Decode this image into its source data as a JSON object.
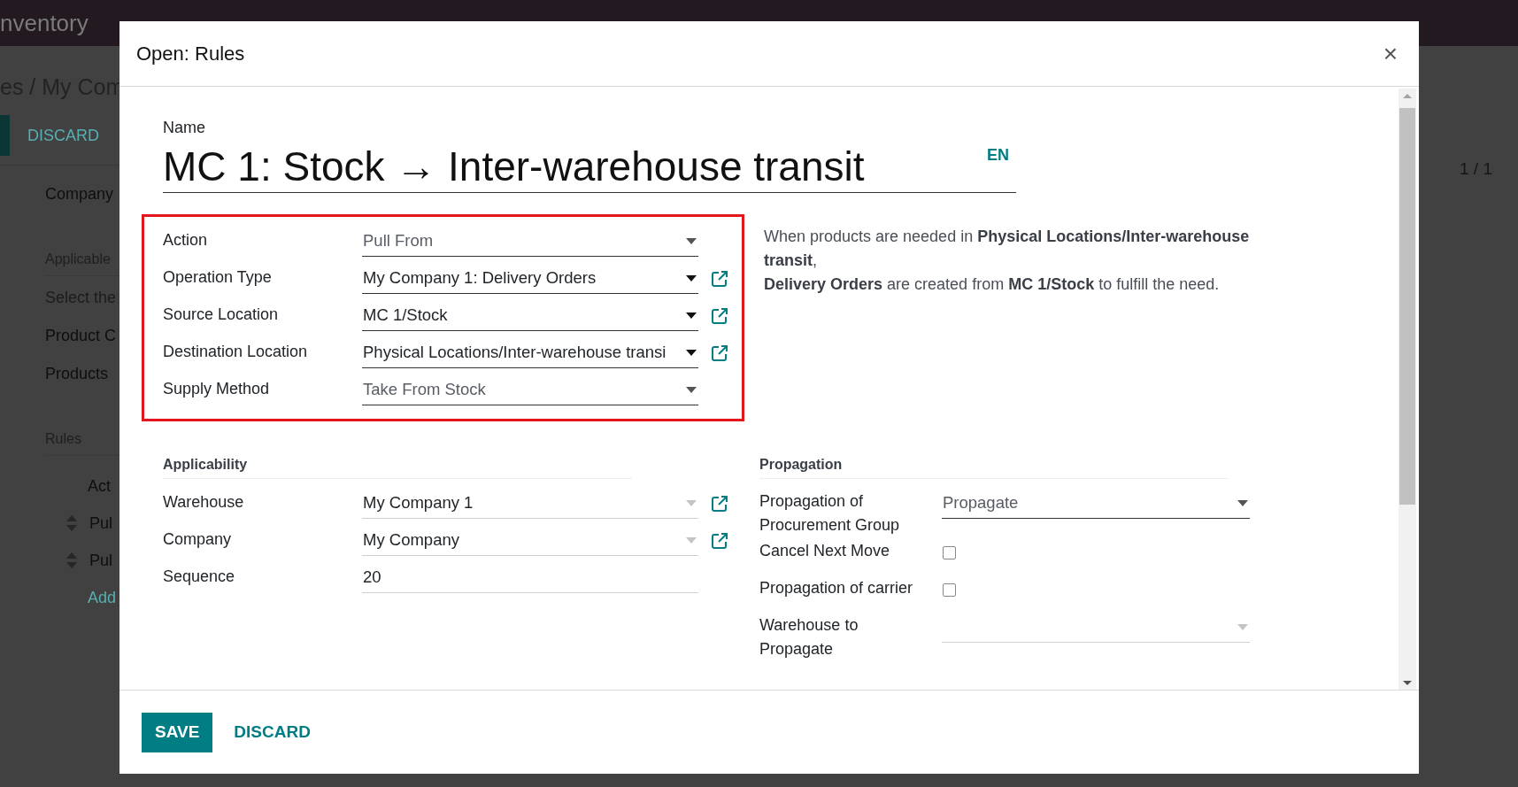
{
  "app_bar": {
    "title": "nventory"
  },
  "background": {
    "breadcrumb": "es / My Com",
    "discard_button": "DISCARD",
    "pager": "1 / 1",
    "items": [
      {
        "kind": "field",
        "text": "Company"
      },
      {
        "kind": "section",
        "text": "Applicable"
      },
      {
        "kind": "placeholder",
        "text": "Select the"
      },
      {
        "kind": "field",
        "text": "Product C"
      },
      {
        "kind": "field",
        "text": "Products"
      },
      {
        "kind": "section",
        "text": "Rules"
      },
      {
        "kind": "column",
        "text": "Act"
      },
      {
        "kind": "row",
        "text": "Pul"
      },
      {
        "kind": "row",
        "text": "Pul"
      },
      {
        "kind": "link",
        "text": "Add"
      }
    ]
  },
  "dialog": {
    "title": "Open: Rules",
    "close": "×",
    "name_label": "Name",
    "name_value": "MC 1: Stock → Inter-warehouse transit",
    "language": "EN",
    "main_group": {
      "highlighted": true,
      "fields": [
        {
          "label": "Action",
          "kind": "selection",
          "value": "Pull From",
          "caret_dimmed": false
        },
        {
          "label": "Operation Type",
          "kind": "many2one",
          "value": "My Company 1: Delivery Orders",
          "caret_dimmed": false
        },
        {
          "label": "Source Location",
          "kind": "many2one",
          "value": "MC 1/Stock",
          "caret_dimmed": false
        },
        {
          "label": "Destination Location",
          "kind": "many2one",
          "value": "Physical Locations/Inter-warehouse transi",
          "caret_dimmed": false
        },
        {
          "label": "Supply Method",
          "kind": "selection",
          "value": "Take From Stock",
          "caret_dimmed": false
        }
      ]
    },
    "description": "When products are needed in **Physical Locations/Inter-warehouse transit**,\n**Delivery Orders** are created from **MC 1/Stock** to fulfill the need.",
    "applicability": {
      "title": "Applicability",
      "fields": [
        {
          "label": "Warehouse",
          "kind": "many2one",
          "value": "My Company 1",
          "caret_dimmed": true
        },
        {
          "label": "Company",
          "kind": "many2one",
          "value": "My Company",
          "caret_dimmed": true
        },
        {
          "label": "Sequence",
          "kind": "text",
          "value": "20"
        }
      ]
    },
    "propagation": {
      "title": "Propagation",
      "fields": [
        {
          "label": "Propagation of Procurement Group",
          "kind": "selection",
          "value": "Propagate",
          "caret_dimmed": false
        },
        {
          "label": "Cancel Next Move",
          "kind": "checkbox",
          "checked": false
        },
        {
          "label": "Propagation of carrier",
          "kind": "checkbox",
          "checked": false
        },
        {
          "label": "Warehouse to Propagate",
          "kind": "selection",
          "caret_dimmed": true
        }
      ]
    },
    "buttons": [
      {
        "label": "SAVE",
        "kind": "primary"
      },
      {
        "label": "DISCARD",
        "kind": "link"
      }
    ]
  }
}
